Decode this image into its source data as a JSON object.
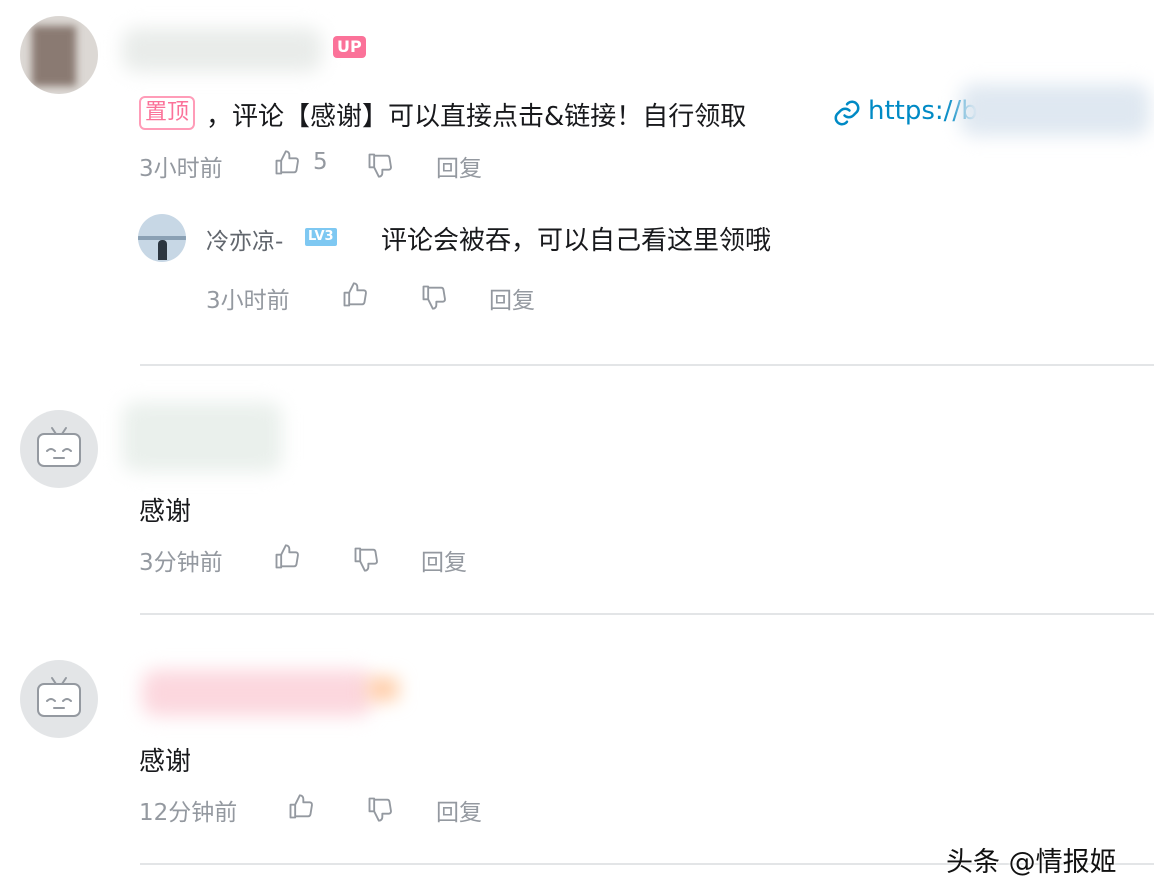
{
  "comments": [
    {
      "badge": "UP",
      "pin_tag": "置顶",
      "text": "，评论【感谢】可以直接点击&链接！自行领取",
      "link_text": "https://b",
      "time": "3小时前",
      "like_count": "5",
      "reply_label": "回复",
      "replies": [
        {
          "username": "冷亦凉-",
          "level": "LV3",
          "text": "评论会被吞，可以自己看这里领哦",
          "time": "3小时前",
          "reply_label": "回复"
        }
      ]
    },
    {
      "text": "感谢",
      "time": "3分钟前",
      "reply_label": "回复"
    },
    {
      "text": "感谢",
      "time": "12分钟前",
      "reply_label": "回复"
    }
  ],
  "watermark": "头条 @情报姬",
  "icons": {
    "like": "thumbs-up-icon",
    "dislike": "thumbs-down-icon",
    "link": "link-icon",
    "avatar_default": "bilibili-tv-avatar"
  },
  "colors": {
    "brand_pink": "#fb7299",
    "meta_gray": "#9499a0",
    "link_blue": "#008ac5"
  }
}
